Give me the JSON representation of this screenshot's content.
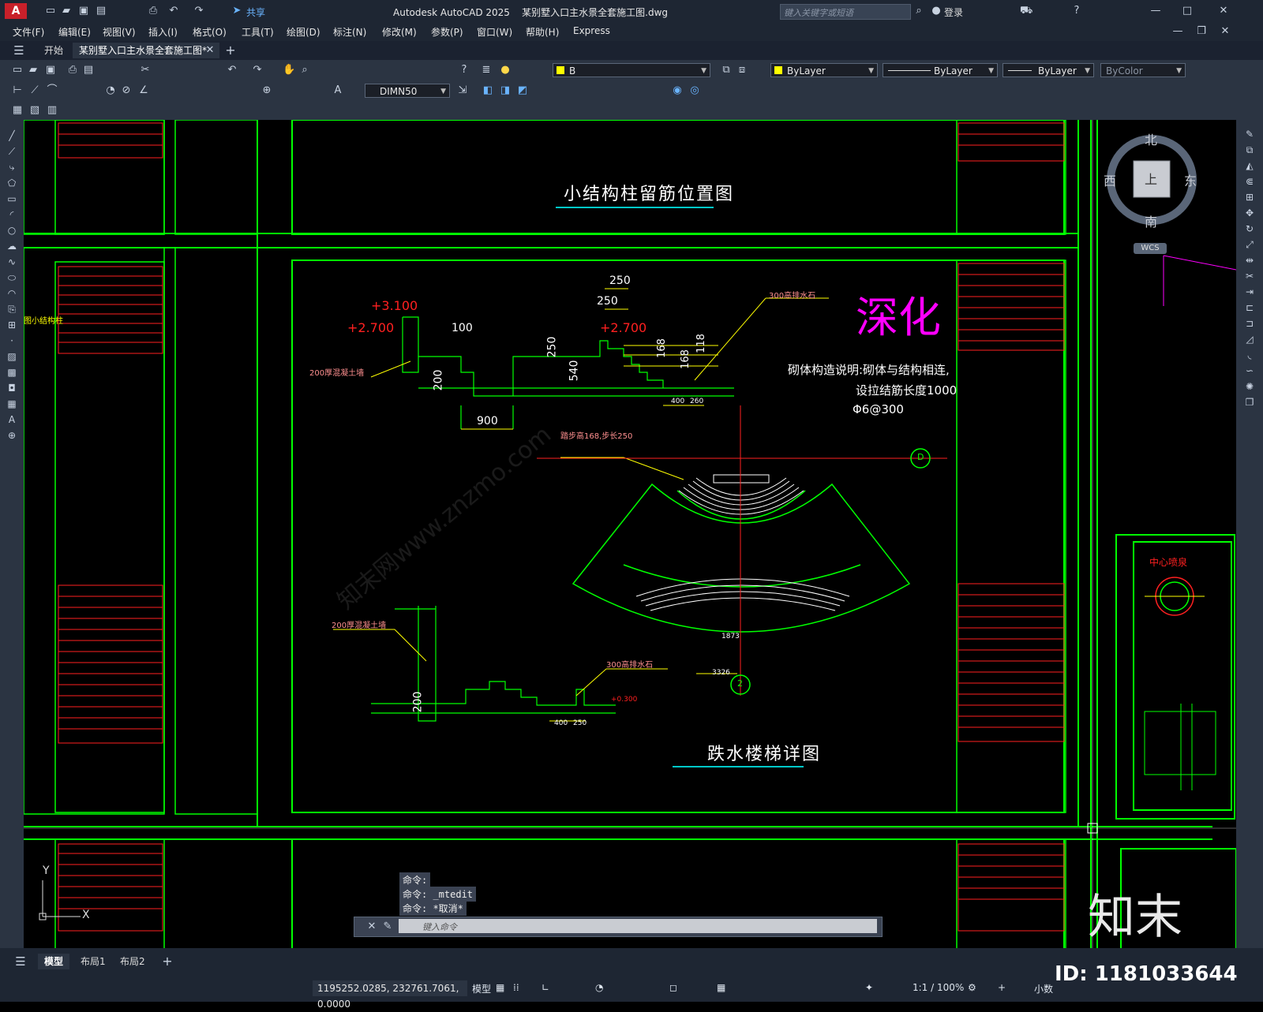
{
  "app": {
    "logo_letter": "A",
    "share_label": "共享",
    "title": "Autodesk AutoCAD 2025    某别墅入口主水景全套施工图.dwg",
    "search_placeholder": "键入关键字或短语",
    "login_label": "登录"
  },
  "menu": [
    "文件(F)",
    "编辑(E)",
    "视图(V)",
    "插入(I)",
    "格式(O)",
    "工具(T)",
    "绘图(D)",
    "标注(N)",
    "修改(M)",
    "参数(P)",
    "窗口(W)",
    "帮助(H)",
    "Express"
  ],
  "doc_tabs": {
    "start": "开始",
    "active": "某别墅入口主水景全套施工图*"
  },
  "toolbar": {
    "layer": "B",
    "color": "ByLayer",
    "linetype": "ByLayer",
    "lineweight": "ByLayer",
    "plotstyle": "ByColor",
    "dimstyle": "DIMN50"
  },
  "viewcube": {
    "north": "北",
    "south": "南",
    "east": "东",
    "west": "西",
    "top": "上",
    "wcs": "WCS"
  },
  "drawing": {
    "title_top": "小结构柱留筋位置图",
    "title_bottom": "跌水楼梯详图",
    "deepen": "深化",
    "note_1": "砌体构造说明:砌体与结构相连,",
    "note_2": "设拉结筋长度1000",
    "note_3": "Φ6@300",
    "left_label": "图小结构柱",
    "elev_1": "+3.100",
    "elev_2": "+2.700",
    "elev_3": "+2.700",
    "dim_250a": "250",
    "dim_250b": "250",
    "dim_100": "100",
    "dim_200": "200",
    "dim_540": "540",
    "dim_250c": "250",
    "dim_168a": "168",
    "dim_168b": "168",
    "dim_118": "118",
    "dim_900": "900",
    "dim_400": "400",
    "dim_260": "260",
    "label_wall": "200厚混凝土墙",
    "label_wall2": "200厚混凝土墙",
    "label_drain": "300高排水石",
    "label_drain2": "300高排水石",
    "label_step": "踏步高168,步长250",
    "dim_1873": "1873",
    "dim_3326": "3326",
    "dim_200b": "200",
    "dim_400b": "400",
    "dim_250d": "250",
    "elev_300": "+0.300",
    "axis_d": "D",
    "axis_2": "2",
    "side_title": "中心喷泉",
    "watermark_1": "知末网www.znzmo.com",
    "y_axis": "Y",
    "x_axis": "X"
  },
  "command": {
    "line1": "命令:",
    "line2": "命令: _mtedit",
    "line3": "命令: *取消*",
    "placeholder": "键入命令"
  },
  "layout_tabs": [
    "模型",
    "布局1",
    "布局2"
  ],
  "status": {
    "coords": "1195252.0285, 232761.7061, 0.0000",
    "model": "模型",
    "scale": "1:1 / 100%",
    "units": "小数"
  },
  "brand": {
    "logo": "知末",
    "id": "ID: 1181033644"
  }
}
